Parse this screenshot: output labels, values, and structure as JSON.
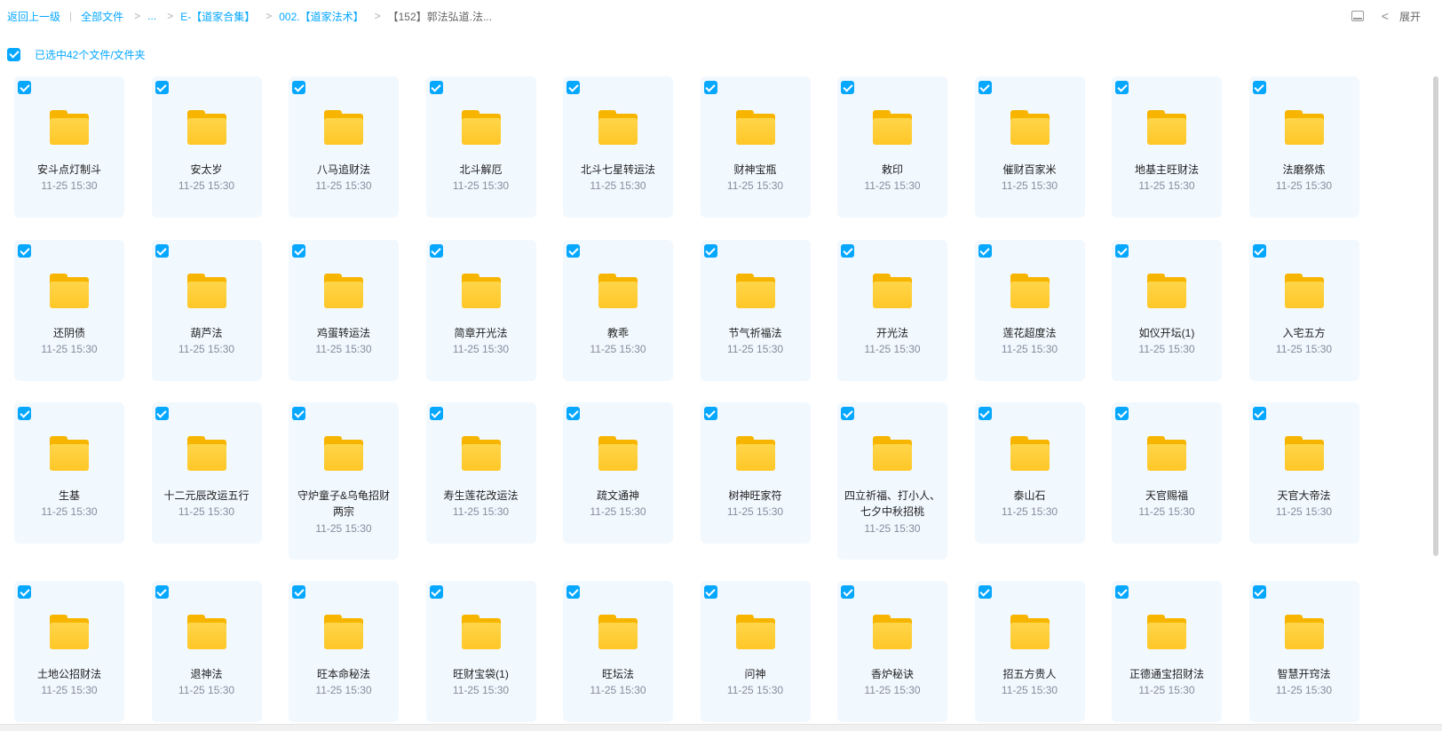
{
  "breadcrumb": {
    "back": "返回上一级",
    "all_files": "全部文件",
    "ellipsis": "...",
    "level1": "E-【道家合集】",
    "level2": "002.【道家法术】",
    "current": "【152】郭法弘道.法..."
  },
  "toolbar": {
    "expand_label": "展开"
  },
  "selection": {
    "text": "已选中42个文件/文件夹"
  },
  "folders": [
    {
      "name": "安斗点灯制斗",
      "date": "11-25 15:30"
    },
    {
      "name": "安太岁",
      "date": "11-25 15:30"
    },
    {
      "name": "八马追财法",
      "date": "11-25 15:30"
    },
    {
      "name": "北斗解厄",
      "date": "11-25 15:30"
    },
    {
      "name": "北斗七星转运法",
      "date": "11-25 15:30"
    },
    {
      "name": "财神宝瓶",
      "date": "11-25 15:30"
    },
    {
      "name": "敕印",
      "date": "11-25 15:30"
    },
    {
      "name": "催财百家米",
      "date": "11-25 15:30"
    },
    {
      "name": "地基主旺财法",
      "date": "11-25 15:30"
    },
    {
      "name": "法磨祭炼",
      "date": "11-25 15:30"
    },
    {
      "name": "还阴债",
      "date": "11-25 15:30"
    },
    {
      "name": "葫芦法",
      "date": "11-25 15:30"
    },
    {
      "name": "鸡蛋转运法",
      "date": "11-25 15:30"
    },
    {
      "name": "简章开光法",
      "date": "11-25 15:30"
    },
    {
      "name": "教乖",
      "date": "11-25 15:30"
    },
    {
      "name": "节气祈福法",
      "date": "11-25 15:30"
    },
    {
      "name": "开光法",
      "date": "11-25 15:30"
    },
    {
      "name": "莲花超度法",
      "date": "11-25 15:30"
    },
    {
      "name": "如仪开坛(1)",
      "date": "11-25 15:30"
    },
    {
      "name": "入宅五方",
      "date": "11-25 15:30"
    },
    {
      "name": "生基",
      "date": "11-25 15:30"
    },
    {
      "name": "十二元辰改运五行",
      "date": "11-25 15:30"
    },
    {
      "name": "守炉童子&乌龟招财 两宗",
      "date": "11-25 15:30"
    },
    {
      "name": "寿生莲花改运法",
      "date": "11-25 15:30"
    },
    {
      "name": "疏文通神",
      "date": "11-25 15:30"
    },
    {
      "name": "树神旺家符",
      "date": "11-25 15:30"
    },
    {
      "name": "四立祈福、打小人、七夕中秋招桃",
      "date": "11-25 15:30"
    },
    {
      "name": "泰山石",
      "date": "11-25 15:30"
    },
    {
      "name": "天官赐福",
      "date": "11-25 15:30"
    },
    {
      "name": "天官大帝法",
      "date": "11-25 15:30"
    },
    {
      "name": "土地公招财法",
      "date": "11-25 15:30"
    },
    {
      "name": "退神法",
      "date": "11-25 15:30"
    },
    {
      "name": "旺本命秘法",
      "date": "11-25 15:30"
    },
    {
      "name": "旺财宝袋(1)",
      "date": "11-25 15:30"
    },
    {
      "name": "旺坛法",
      "date": "11-25 15:30"
    },
    {
      "name": "问神",
      "date": "11-25 15:30"
    },
    {
      "name": "香炉秘诀",
      "date": "11-25 15:30"
    },
    {
      "name": "招五方贵人",
      "date": "11-25 15:30"
    },
    {
      "name": "正德通宝招财法",
      "date": "11-25 15:30"
    },
    {
      "name": "智慧开窍法",
      "date": "11-25 15:30"
    }
  ],
  "colors": {
    "accent": "#06a7ff",
    "card_bg": "#f1f8fe",
    "folder": "#ffc727"
  }
}
